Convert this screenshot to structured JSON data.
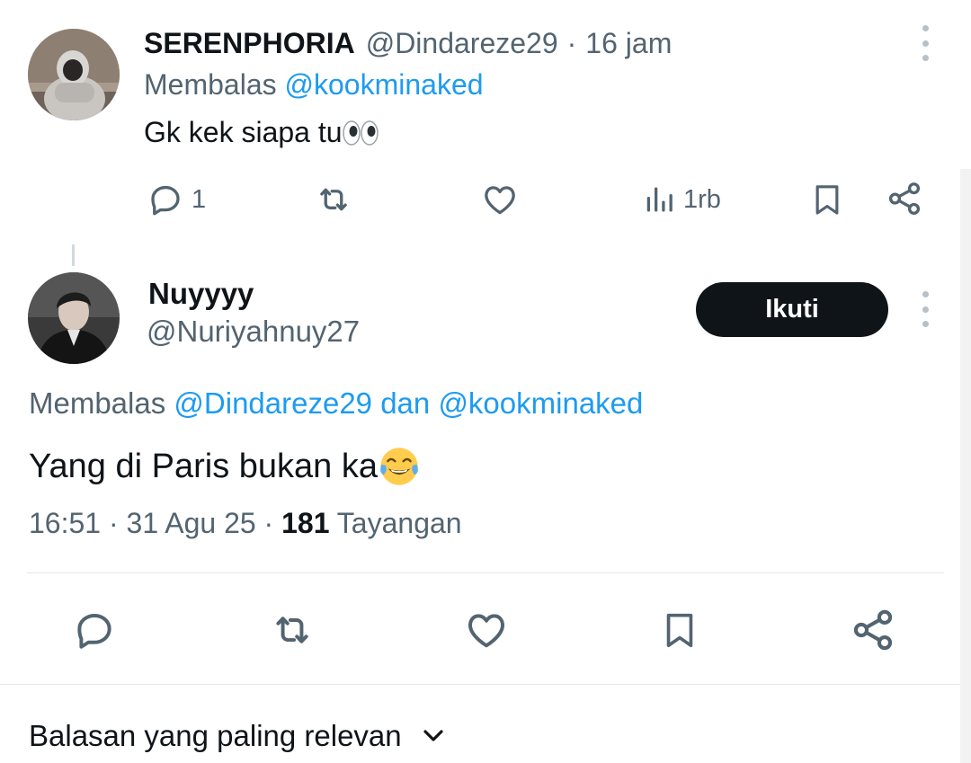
{
  "parent_tweet": {
    "display_name": "SERENPHORIA",
    "handle": "@Dindareze29",
    "separator": "·",
    "time": "16 jam",
    "replying_label": "Membalas",
    "replying_to": "@kookminaked",
    "text": "Gk kek siapa tu",
    "text_emoji": "eyes",
    "reply_count": "1",
    "view_count": "1rb"
  },
  "main_tweet": {
    "display_name": "Nuyyyy",
    "handle": "@Nuriyahnuy27",
    "follow_label": "Ikuti",
    "replying_label": "Membalas",
    "replying_to_1": "@Dindareze29",
    "replying_conjunction": "dan",
    "replying_to_2": "@kookminaked",
    "text": "Yang di Paris bukan ka",
    "text_emoji": "face-with-tears-of-joy",
    "time": "16:51",
    "separator": "·",
    "date": "31 Agu 25",
    "views_count": "181",
    "views_label": "Tayangan"
  },
  "replies_sort": {
    "label": "Balasan yang paling relevan"
  },
  "colors": {
    "text": "#0f1419",
    "muted": "#536471",
    "link": "#1d9bf0",
    "follow_button_bg": "#0f1419",
    "divider": "#e1e8ed"
  }
}
